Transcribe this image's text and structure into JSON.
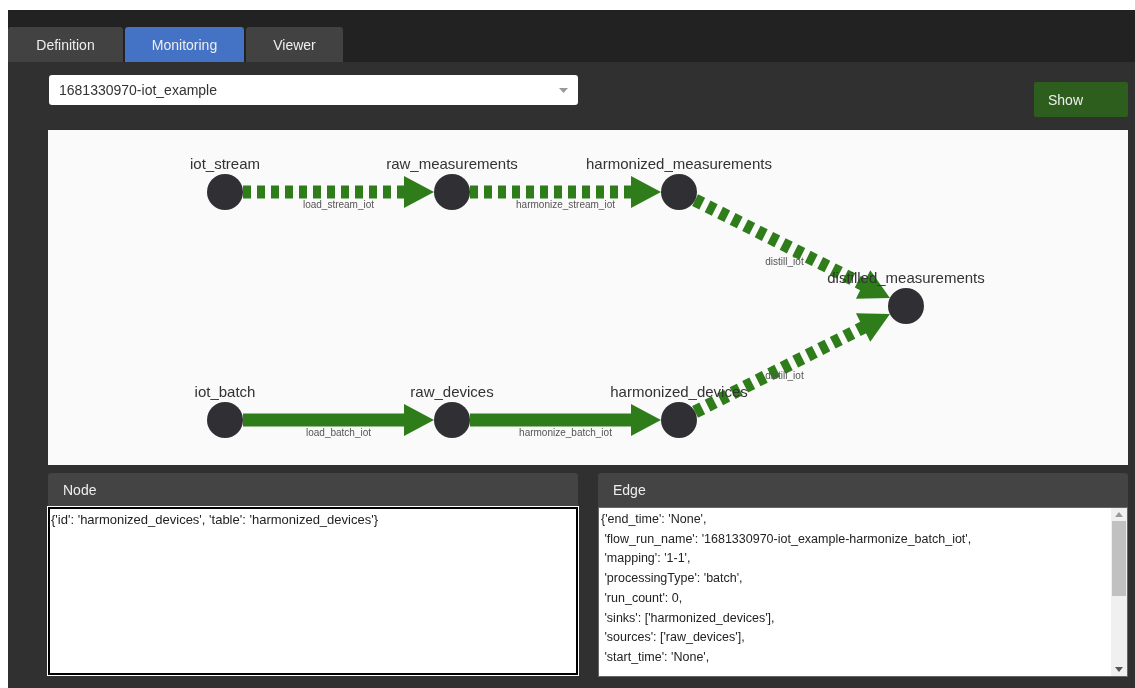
{
  "tabs": [
    {
      "label": "Definition",
      "selected": false
    },
    {
      "label": "Monitoring",
      "selected": true
    },
    {
      "label": "Viewer",
      "selected": false
    }
  ],
  "run_select": {
    "value": "1681330970-iot_example"
  },
  "show_button": {
    "label": "Show"
  },
  "graph": {
    "lanes": [
      {
        "nodes": [
          {
            "id": "iot_stream"
          },
          {
            "id": "raw_measurements"
          },
          {
            "id": "harmonized_measurements"
          }
        ],
        "edges": [
          {
            "label": "load_stream_iot",
            "kind": "stream"
          },
          {
            "label": "harmonize_stream_iot",
            "kind": "stream"
          }
        ],
        "exit_edge": {
          "label": "distill_iot",
          "kind": "stream"
        }
      },
      {
        "nodes": [
          {
            "id": "iot_batch"
          },
          {
            "id": "raw_devices"
          },
          {
            "id": "harmonized_devices"
          }
        ],
        "edges": [
          {
            "label": "load_batch_iot",
            "kind": "batch"
          },
          {
            "label": "harmonize_batch_iot",
            "kind": "batch"
          }
        ],
        "exit_edge": {
          "label": "distill_iot",
          "kind": "stream"
        }
      }
    ],
    "sink": {
      "id": "distilled_measurements"
    }
  },
  "node_panel": {
    "title": "Node",
    "text": "{'id': 'harmonized_devices', 'table': 'harmonized_devices'}"
  },
  "edge_panel": {
    "title": "Edge",
    "lines": [
      "{'end_time': 'None',",
      " 'flow_run_name': '1681330970-iot_example-harmonize_batch_iot',",
      " 'mapping': '1-1',",
      " 'processingType': 'batch',",
      " 'run_count': 0,",
      " 'sinks': ['harmonized_devices'],",
      " 'sources': ['raw_devices'],",
      " 'start_time': 'None',"
    ]
  }
}
